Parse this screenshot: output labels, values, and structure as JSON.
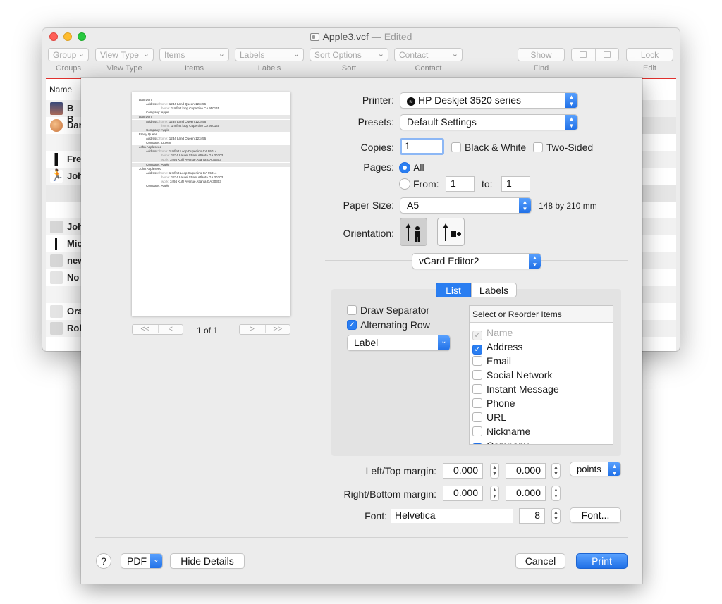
{
  "window": {
    "title": "Apple3.vcf",
    "title_status": "— Edited",
    "toolbar": {
      "buttons": [
        {
          "label": "Group",
          "caption": "Groups"
        },
        {
          "label": "View Type",
          "caption": "View Type"
        },
        {
          "label": "Items",
          "caption": "Items"
        },
        {
          "label": "Labels",
          "caption": "Labels"
        },
        {
          "label": "Sort Options",
          "caption": "Sort"
        },
        {
          "label": "Contact",
          "caption": "Contact"
        }
      ],
      "show": {
        "label": "Show",
        "caption": "Find"
      },
      "lock": {
        "label": "Lock",
        "caption": "Edit"
      }
    },
    "list_header": "Name",
    "rows": [
      {
        "name": "B B"
      },
      {
        "name": "Dar"
      },
      {
        "name": ""
      },
      {
        "name": "Fre"
      },
      {
        "name": "Joh"
      },
      {
        "name": ""
      },
      {
        "name": ""
      },
      {
        "name": "Joh"
      },
      {
        "name": "Mic"
      },
      {
        "name": "new"
      },
      {
        "name": "No"
      },
      {
        "name": ""
      },
      {
        "name": "Ora"
      },
      {
        "name": "Rol"
      }
    ]
  },
  "print": {
    "preview_lines": [
      {
        "t": "Dan Don"
      },
      {
        "k": "Address:",
        "w": "home",
        "v": "1234 Land Queen 123456"
      },
      {
        "w": "home",
        "v": "1 Infinit loop Cupertino CA 950145"
      },
      {
        "k": "Company:",
        "v": "Apple"
      },
      {
        "t": "Dan Don"
      },
      {
        "k": "Address:",
        "w": "home",
        "v": "1234 Land Queen 123456"
      },
      {
        "w": "home",
        "v": "1 Infinit loop Cupertino CA 950145"
      },
      {
        "k": "Company:",
        "v": "Apple"
      },
      {
        "t": "Fredy Queen"
      },
      {
        "k": "Address:",
        "w": "home",
        "v": "1234 Land Queen 123456"
      },
      {
        "k": "Company:",
        "v": "Queen"
      },
      {
        "t": "John Appleseed"
      },
      {
        "k": "Address:",
        "w": "home",
        "v": "1 Infinit Loop Cupertino CA 95014"
      },
      {
        "w": "home",
        "v": "1234 Laurel Street Atlanta GA 30303"
      },
      {
        "w": "work",
        "v": "3494 Kuhl Avenue Atlanta GA 30303"
      },
      {
        "k": "Company:",
        "v": "Apple"
      },
      {
        "t": "John Appleseed"
      },
      {
        "k": "Address:",
        "w": "home",
        "v": "1 Infinit Loop Cupertino CA 95014"
      },
      {
        "w": "home",
        "v": "1234 Laurel Street Atlanta GA 30303"
      },
      {
        "w": "work",
        "v": "3494 Kuhl Avenue Atlanta GA 30303"
      },
      {
        "k": "Company:",
        "v": "Apple"
      }
    ],
    "page_nav": {
      "first": "<<",
      "prev": "<",
      "next": ">",
      "last": ">>",
      "text": "1 of 1"
    },
    "printer": {
      "label": "Printer:",
      "value": "HP Deskjet 3520 series"
    },
    "presets": {
      "label": "Presets:",
      "value": "Default Settings"
    },
    "copies": {
      "label": "Copies:",
      "value": "1",
      "bw": "Black & White",
      "two_sided": "Two-Sided"
    },
    "pages": {
      "label": "Pages:",
      "all": "All",
      "from": "From:",
      "from_value": "1",
      "to": "to:",
      "to_value": "1"
    },
    "paper": {
      "label": "Paper Size:",
      "value": "A5",
      "dims": "148 by 210 mm"
    },
    "orientation": {
      "label": "Orientation:"
    },
    "app_menu": "vCard Editor2",
    "tabs": {
      "list": "List",
      "labels": "Labels"
    },
    "draw_separator": "Draw Separator",
    "alternating_row": "Alternating Row",
    "style_popup": "Label",
    "items_header": "Select or Reorder Items",
    "items": [
      {
        "label": "Name",
        "state": "dim"
      },
      {
        "label": "Address",
        "state": "on"
      },
      {
        "label": "Email",
        "state": "off"
      },
      {
        "label": "Social Network",
        "state": "off"
      },
      {
        "label": "Instant Message",
        "state": "off"
      },
      {
        "label": "Phone",
        "state": "off"
      },
      {
        "label": "URL",
        "state": "off"
      },
      {
        "label": "Nickname",
        "state": "off"
      },
      {
        "label": "Company",
        "state": "on"
      }
    ],
    "margins": {
      "lt_label": "Left/Top margin:",
      "lt_left": "0.000",
      "lt_top": "0.000",
      "rb_label": "Right/Bottom margin:",
      "rb_right": "0.000",
      "rb_bottom": "0.000",
      "units": "points"
    },
    "font": {
      "label": "Font:",
      "name": "Helvetica",
      "size": "8",
      "button": "Font..."
    },
    "footer": {
      "help": "?",
      "pdf": "PDF",
      "hide": "Hide Details",
      "cancel": "Cancel",
      "print": "Print"
    }
  }
}
